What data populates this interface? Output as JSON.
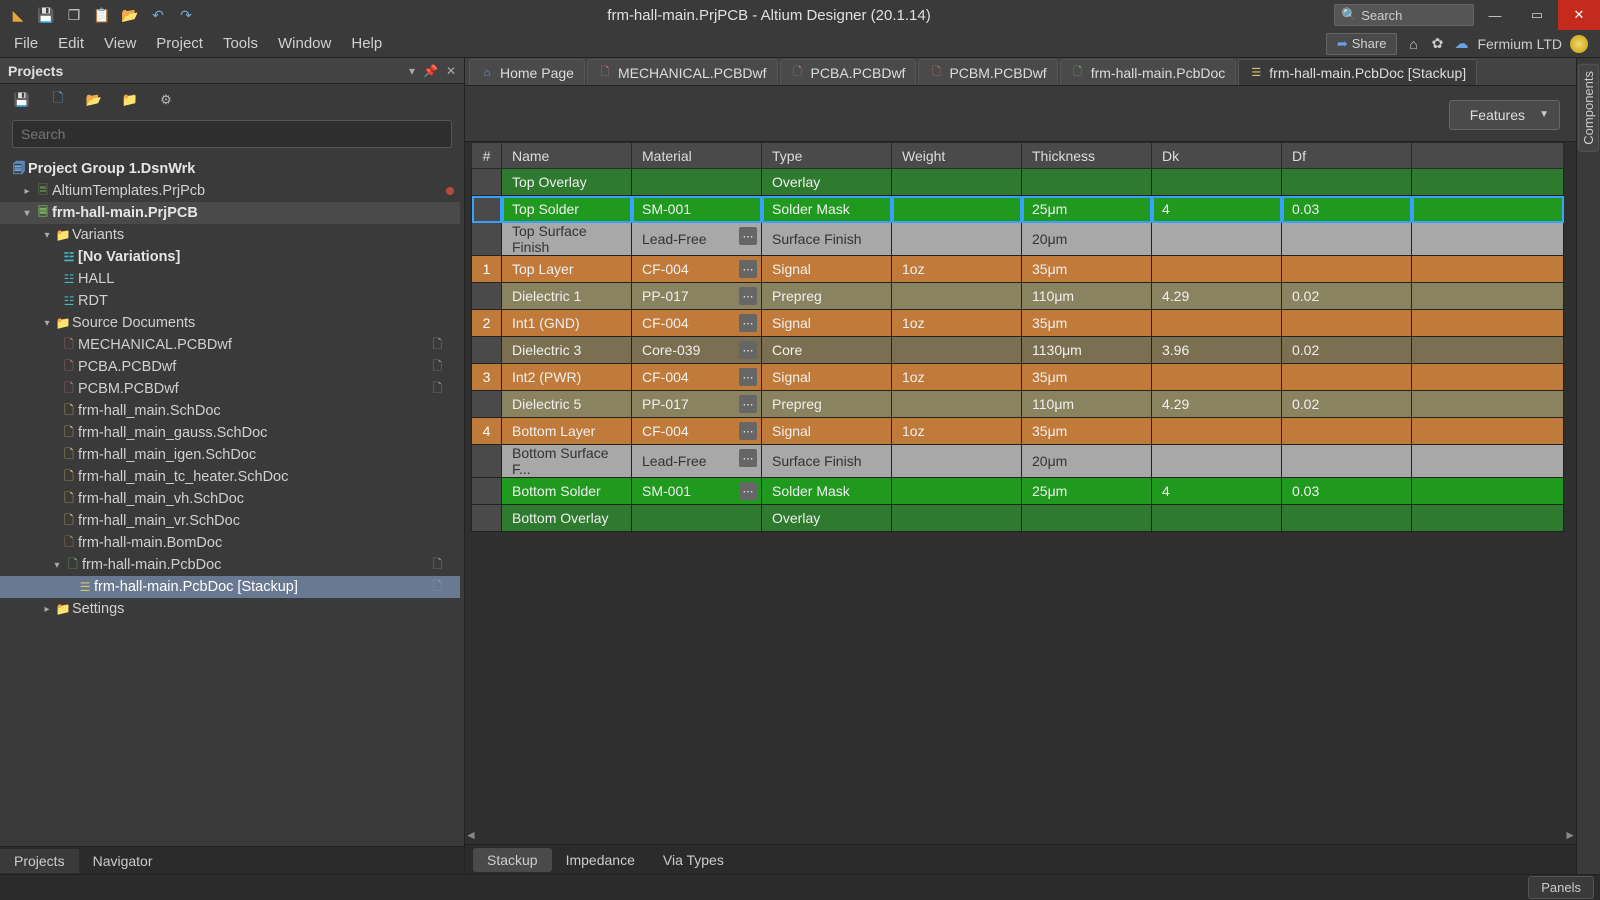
{
  "titlebar": {
    "title": "frm-hall-main.PrjPCB - Altium Designer (20.1.14)",
    "search_placeholder": "Search"
  },
  "menubar": {
    "items": [
      "File",
      "Edit",
      "View",
      "Project",
      "Tools",
      "Window",
      "Help"
    ],
    "share": "Share",
    "org": "Fermium LTD"
  },
  "projects_panel": {
    "title": "Projects",
    "search_placeholder": "Search",
    "bottom_tabs": [
      "Projects",
      "Navigator"
    ],
    "tree": {
      "group": "Project Group 1.DsnWrk",
      "proj1": "AltiumTemplates.PrjPcb",
      "proj2": "frm-hall-main.PrjPCB",
      "variants_folder": "Variants",
      "novar": "[No Variations]",
      "hall": "HALL",
      "rdt": "RDT",
      "src_folder": "Source Documents",
      "docs": [
        "MECHANICAL.PCBDwf",
        "PCBA.PCBDwf",
        "PCBM.PCBDwf",
        "frm-hall_main.SchDoc",
        "frm-hall_main_gauss.SchDoc",
        "frm-hall_main_igen.SchDoc",
        "frm-hall_main_tc_heater.SchDoc",
        "frm-hall_main_vh.SchDoc",
        "frm-hall_main_vr.SchDoc",
        "frm-hall-main.BomDoc",
        "frm-hall-main.PcbDoc",
        "frm-hall-main.PcbDoc [Stackup]"
      ],
      "settings": "Settings"
    }
  },
  "doc_tabs": [
    {
      "label": "Home Page",
      "icon": "home",
      "color": "#6aa3e0"
    },
    {
      "label": "MECHANICAL.PCBDwf",
      "icon": "dwf",
      "color": "#c97a7a"
    },
    {
      "label": "PCBA.PCBDwf",
      "icon": "dwf",
      "color": "#c97a7a"
    },
    {
      "label": "PCBM.PCBDwf",
      "icon": "dwf",
      "color": "#c97a7a"
    },
    {
      "label": "frm-hall-main.PcbDoc",
      "icon": "pcb",
      "color": "#7ab65a"
    },
    {
      "label": "frm-hall-main.PcbDoc [Stackup]",
      "icon": "stack",
      "color": "#d8c468",
      "active": true
    }
  ],
  "features_label": "Features",
  "stackup": {
    "headers": [
      "#",
      "Name",
      "Material",
      "Type",
      "Weight",
      "Thickness",
      "Dk",
      "Df"
    ],
    "rows": [
      {
        "idx": "",
        "name": "Top Overlay",
        "mat": "",
        "type": "Overlay",
        "wt": "",
        "th": "",
        "dk": "",
        "df": "",
        "cls": "clr-overlay"
      },
      {
        "idx": "",
        "name": "Top Solder",
        "mat": "SM-001",
        "type": "Solder Mask",
        "wt": "",
        "th": "25μm",
        "dk": "4",
        "df": "0.03",
        "cls": "clr-solder",
        "ell": false,
        "selected": true
      },
      {
        "idx": "",
        "name": "Top Surface Finish",
        "mat": "Lead-Free",
        "type": "Surface Finish",
        "wt": "",
        "th": "20μm",
        "dk": "",
        "df": "",
        "cls": "clr-finish",
        "ell": true
      },
      {
        "idx": "1",
        "name": "Top Layer",
        "mat": "CF-004",
        "type": "Signal",
        "wt": "1oz",
        "th": "35μm",
        "dk": "",
        "df": "",
        "cls": "clr-signal",
        "ell": true,
        "sigidx": true
      },
      {
        "idx": "",
        "name": "Dielectric 1",
        "mat": "PP-017",
        "type": "Prepreg",
        "wt": "",
        "th": "110μm",
        "dk": "4.29",
        "df": "0.02",
        "cls": "clr-prepreg",
        "ell": true
      },
      {
        "idx": "2",
        "name": "Int1 (GND)",
        "mat": "CF-004",
        "type": "Signal",
        "wt": "1oz",
        "th": "35μm",
        "dk": "",
        "df": "",
        "cls": "clr-signal",
        "ell": true,
        "sigidx": true
      },
      {
        "idx": "",
        "name": "Dielectric 3",
        "mat": "Core-039",
        "type": "Core",
        "wt": "",
        "th": "1130μm",
        "dk": "3.96",
        "df": "0.02",
        "cls": "clr-core",
        "ell": true
      },
      {
        "idx": "3",
        "name": "Int2 (PWR)",
        "mat": "CF-004",
        "type": "Signal",
        "wt": "1oz",
        "th": "35μm",
        "dk": "",
        "df": "",
        "cls": "clr-signal",
        "ell": true,
        "sigidx": true
      },
      {
        "idx": "",
        "name": "Dielectric 5",
        "mat": "PP-017",
        "type": "Prepreg",
        "wt": "",
        "th": "110μm",
        "dk": "4.29",
        "df": "0.02",
        "cls": "clr-prepreg",
        "ell": true
      },
      {
        "idx": "4",
        "name": "Bottom Layer",
        "mat": "CF-004",
        "type": "Signal",
        "wt": "1oz",
        "th": "35μm",
        "dk": "",
        "df": "",
        "cls": "clr-signal",
        "ell": true,
        "sigidx": true
      },
      {
        "idx": "",
        "name": "Bottom Surface F...",
        "mat": "Lead-Free",
        "type": "Surface Finish",
        "wt": "",
        "th": "20μm",
        "dk": "",
        "df": "",
        "cls": "clr-finish",
        "ell": true
      },
      {
        "idx": "",
        "name": "Bottom Solder",
        "mat": "SM-001",
        "type": "Solder Mask",
        "wt": "",
        "th": "25μm",
        "dk": "4",
        "df": "0.03",
        "cls": "clr-solder",
        "ell": true
      },
      {
        "idx": "",
        "name": "Bottom Overlay",
        "mat": "",
        "type": "Overlay",
        "wt": "",
        "th": "",
        "dk": "",
        "df": "",
        "cls": "clr-overlay"
      }
    ],
    "bottom_tabs": [
      "Stackup",
      "Impedance",
      "Via Types"
    ]
  },
  "right_strip": {
    "tab": "Components"
  },
  "statusbar": {
    "panels": "Panels"
  }
}
